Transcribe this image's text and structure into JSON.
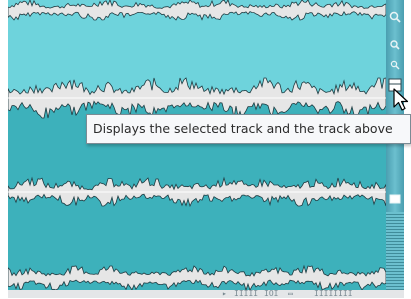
{
  "tooltip": {
    "text": "Displays the selected track and the track above"
  },
  "colors": {
    "track_top_fill": "#6ed3dc",
    "track_bottom_fill": "#3db1bb",
    "waveform_line": "#1f3a40",
    "channel_divider": "#e6e6e6",
    "sidebar": "#5fb5c5",
    "tooltip_bg": "#f7f8fa",
    "tooltip_border": "#7b8b94"
  },
  "icons": {
    "zoom_in": "magnifier-plus-icon",
    "zoom_out": "magnifier-minus-icon",
    "show_track_above": "split-track-icon",
    "single_track": "track-box-icon",
    "cursor": "mouse-pointer-icon"
  },
  "bottom_bar": {
    "glyphs": [
      "▸",
      "IIIII",
      "IOI",
      "▭",
      "IIIIIIII"
    ]
  }
}
